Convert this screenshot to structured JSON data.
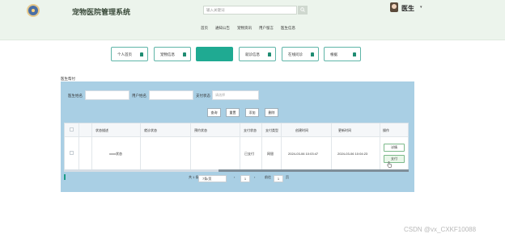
{
  "app": {
    "title": "宠物医院管理系统"
  },
  "search": {
    "placeholder": "输入关键词"
  },
  "user": {
    "name": "医生"
  },
  "topnav": [
    "首页",
    "通知公告",
    "宠物资讯",
    "用户留言",
    "医生信息"
  ],
  "modules": [
    {
      "label": "个人首页",
      "active": false
    },
    {
      "label": "宠物信息",
      "active": false
    },
    {
      "label": "",
      "active": true
    },
    {
      "label": "就诊信息",
      "active": false
    },
    {
      "label": "在线问诊",
      "active": false
    },
    {
      "label": "根据",
      "active": false
    }
  ],
  "page": {
    "label": "医生帮付"
  },
  "filters": {
    "doctor_label": "医生姓名",
    "user_label": "用户姓名",
    "pay_label": "支付状态",
    "pay_placeholder": "请选择"
  },
  "actions": {
    "query": "查询",
    "reset": "重置",
    "add": "添加",
    "delete": "删除"
  },
  "table": {
    "headers": [
      "状态描述",
      "就诊状态",
      "预约状态",
      "支付状态",
      "支付类型",
      "创建时间",
      "更新时间",
      "操作"
    ],
    "rows": [
      {
        "status_desc": "xxxx状态",
        "visit_status": "",
        "appointment_status": "",
        "pay_status": "已支付",
        "pay_type": "网银",
        "created": "2024-03-06 10:03:47",
        "updated": "2024-03-06 10:04:23"
      }
    ],
    "row_actions": {
      "detail": "详情",
      "pay": "支付"
    }
  },
  "pagination": {
    "total": "共 1 条",
    "page_size": "7条/页",
    "current": "1",
    "goto_label": "前往",
    "goto_value": "1",
    "page_unit": "页"
  },
  "watermark": "CSDN @vx_CXKF10088"
}
